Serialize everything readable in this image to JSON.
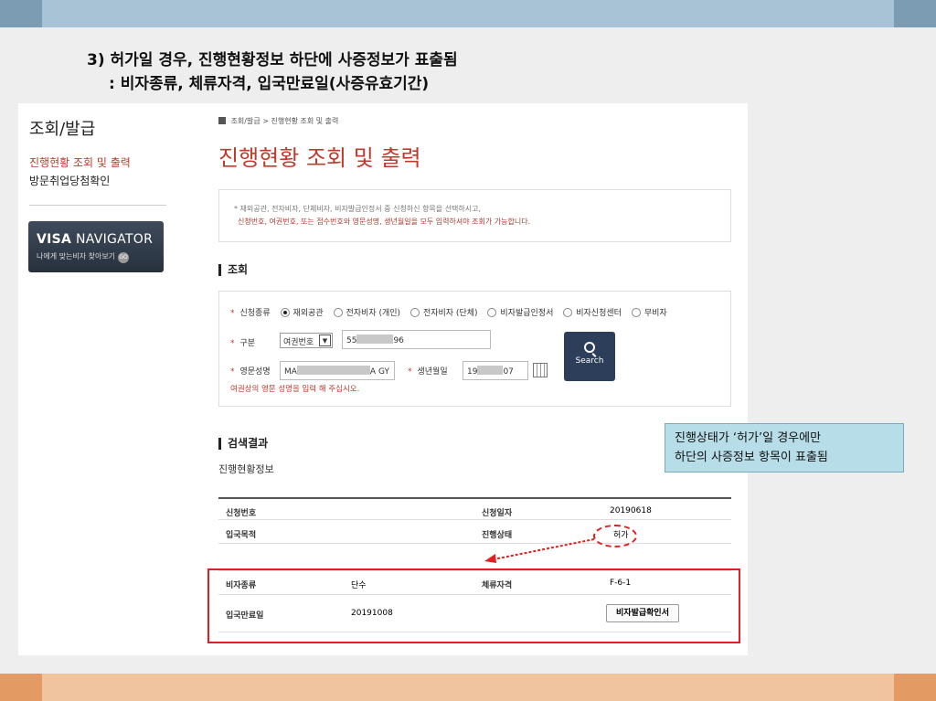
{
  "slide": {
    "title_line1": "3) 허가일 경우, 진행현황정보 하단에 사증정보가 표출됨",
    "title_line2": ": 비자종류, 체류자격, 입국만료일(사증유효기간)",
    "callout_line1": "진행상태가 ‘허가’일 경우에만",
    "callout_line2": "하단의 사증정보 항목이 표출됨",
    "highlight_color": "#e02020"
  },
  "sidebar": {
    "title": "조회/발급",
    "items": [
      {
        "label": "진행현황 조회 및 출력",
        "active": true
      },
      {
        "label": "방문취업당첨확인",
        "active": false
      }
    ],
    "banner": {
      "brand": "VISA",
      "name": "NAVIGATOR",
      "subtitle": "나에게 맞는비자 찾아보기",
      "go": "GO"
    }
  },
  "breadcrumb": {
    "items": [
      "조회/발급",
      "진행현황 조회 및 출력"
    ],
    "separator": ">"
  },
  "page_title": "진행현황 조회 및 출력",
  "notice": {
    "line1": "* 재외공관, 전자비자, 단체비자, 비자발급인정서 중 신청하신 항목을 선택하시고,",
    "line2": "신청번호, 여권번호, 또는 접수번호와 영문성명, 생년월일을 모두 입력하셔야 조회가 가능합니다."
  },
  "search": {
    "heading": "조회",
    "type_label": "신청종류",
    "type_options": [
      "재외공관",
      "전자비자 (개인)",
      "전자비자 (단체)",
      "비자발급인정서",
      "비자신청센터",
      "무비자"
    ],
    "type_selected": "재외공관",
    "gubun_label": "구분",
    "gubun_select": "여권번호",
    "passport_prefix": "55",
    "passport_suffix": "96",
    "name_label": "영문성명",
    "name_prefix": "MA",
    "name_suffix": "A GY",
    "birth_label": "생년월일",
    "birth_prefix": "19",
    "birth_suffix": "07",
    "hint": "여권상의 영문 성명을 입력 해 주십시오.",
    "button_label": "Search"
  },
  "result": {
    "heading": "검색결과",
    "subheading": "진행현황정보",
    "rows": [
      {
        "label1": "신청번호",
        "value1": "",
        "label2": "신청일자",
        "value2": "20190618"
      },
      {
        "label1": "입국목적",
        "value1": "",
        "label2": "진행상태",
        "value2": "허가"
      }
    ]
  },
  "visa_info": {
    "rows": [
      {
        "label1": "비자종류",
        "value1": "단수",
        "label2": "체류자격",
        "value2": "F-6-1"
      },
      {
        "label1": "입국만료일",
        "value1": "20191008"
      }
    ],
    "button_label": "비자발급확인서"
  }
}
